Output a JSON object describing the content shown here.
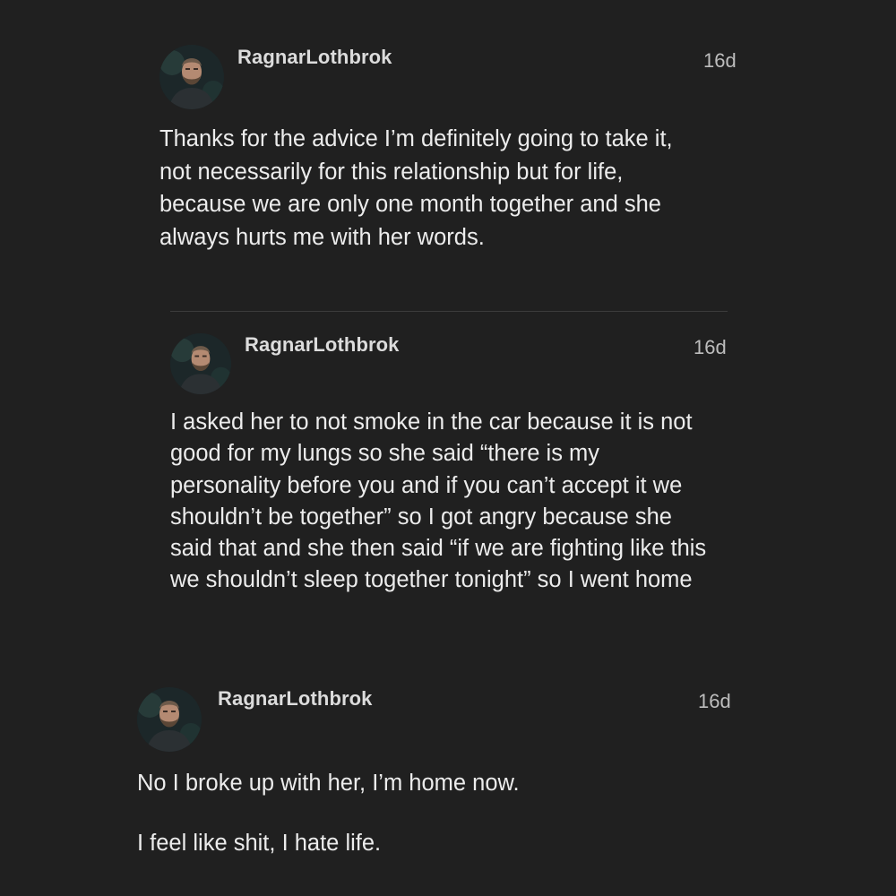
{
  "comments": [
    {
      "username": "RagnarLothbrok",
      "timestamp": "16d",
      "avatar_icon": "user-avatar-icon",
      "lines": [
        "Thanks for the advice I’m definitely going to take it,",
        "not necessarily for this relationship but for life,",
        "because we are only one month together and she",
        "always hurts me with her words."
      ]
    },
    {
      "username": "RagnarLothbrok",
      "timestamp": "16d",
      "avatar_icon": "user-avatar-icon",
      "lines": [
        "I asked her to not smoke in the car because it is not",
        "good for my lungs so she said “there is my",
        "personality before you and if you can’t accept it we",
        "shouldn’t be together” so I got angry because she",
        "said that and she then said “if we are fighting like this",
        "we shouldn’t sleep together tonight” so I went home"
      ]
    },
    {
      "username": "RagnarLothbrok",
      "timestamp": "16d",
      "avatar_icon": "user-avatar-icon",
      "paragraphs": [
        "No I broke up with her, I’m home now.",
        "I feel like shit, I hate life."
      ]
    }
  ],
  "colors": {
    "background": "#202020",
    "text": "#ececec",
    "username": "#dcdcdc",
    "timestamp": "#bdbdbd",
    "divider": "#3c3c3c"
  }
}
